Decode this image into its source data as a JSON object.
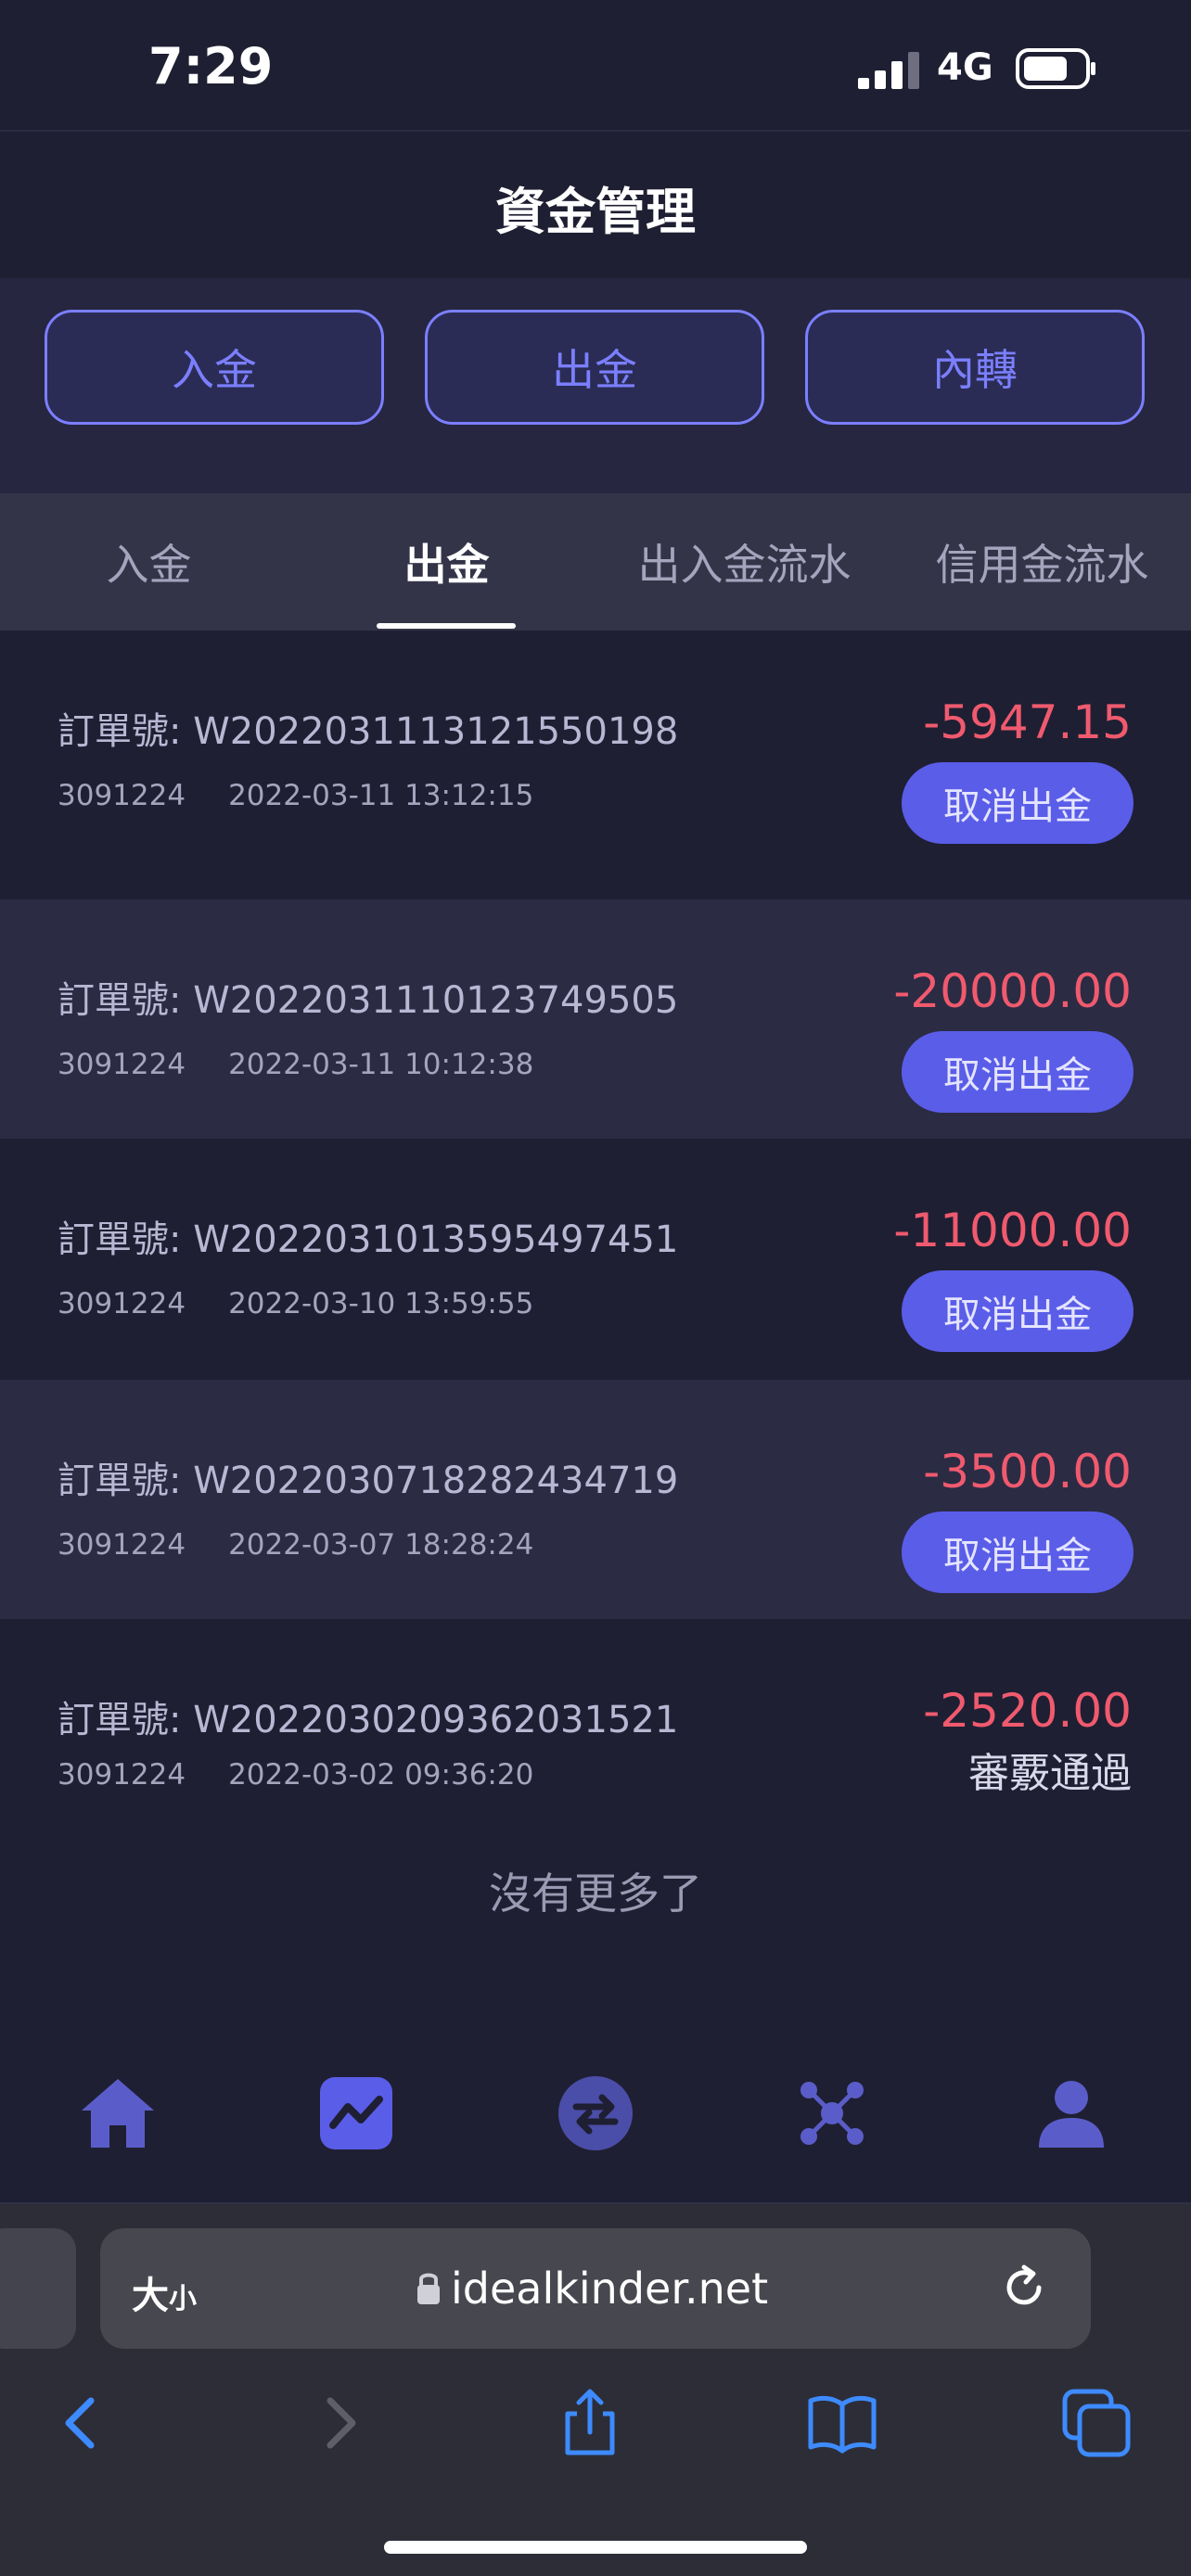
{
  "status_bar": {
    "time": "7:29",
    "network": "4G"
  },
  "header": {
    "title": "資金管理"
  },
  "actions": {
    "deposit": "入金",
    "withdraw": "出金",
    "transfer": "內轉"
  },
  "tabs": [
    {
      "label": "入金"
    },
    {
      "label": "出金"
    },
    {
      "label": "出入金流水"
    },
    {
      "label": "信用金流水"
    }
  ],
  "active_tab": "出金",
  "orders": [
    {
      "order_label": "訂單號:",
      "order_no": "W2022031113121550198",
      "account": "3091224",
      "datetime": "2022-03-11 13:12:15",
      "amount": "-5947.15",
      "action": "取消出金"
    },
    {
      "order_label": "訂單號:",
      "order_no": "W2022031110123749505",
      "account": "3091224",
      "datetime": "2022-03-11 10:12:38",
      "amount": "-20000.00",
      "action": "取消出金"
    },
    {
      "order_label": "訂單號:",
      "order_no": "W2022031013595497451",
      "account": "3091224",
      "datetime": "2022-03-10 13:59:55",
      "amount": "-11000.00",
      "action": "取消出金"
    },
    {
      "order_label": "訂單號:",
      "order_no": "W2022030718282434719",
      "account": "3091224",
      "datetime": "2022-03-07 18:28:24",
      "amount": "-3500.00",
      "action": "取消出金"
    },
    {
      "order_label": "訂單號:",
      "order_no": "W2022030209362031521",
      "account": "3091224",
      "datetime": "2022-03-02 09:36:20",
      "amount": "-2520.00",
      "status": "審覈通過"
    }
  ],
  "no_more": "沒有更多了",
  "app_nav": [
    "home-icon",
    "chart-icon",
    "exchange-icon",
    "network-icon",
    "user-icon"
  ],
  "browser": {
    "text_size_label": "大",
    "text_size_small": "小",
    "url": "idealkinder.net"
  },
  "colors": {
    "accent": "#5a5de8",
    "negative": "#f05a6e",
    "background": "#1f1f33"
  }
}
